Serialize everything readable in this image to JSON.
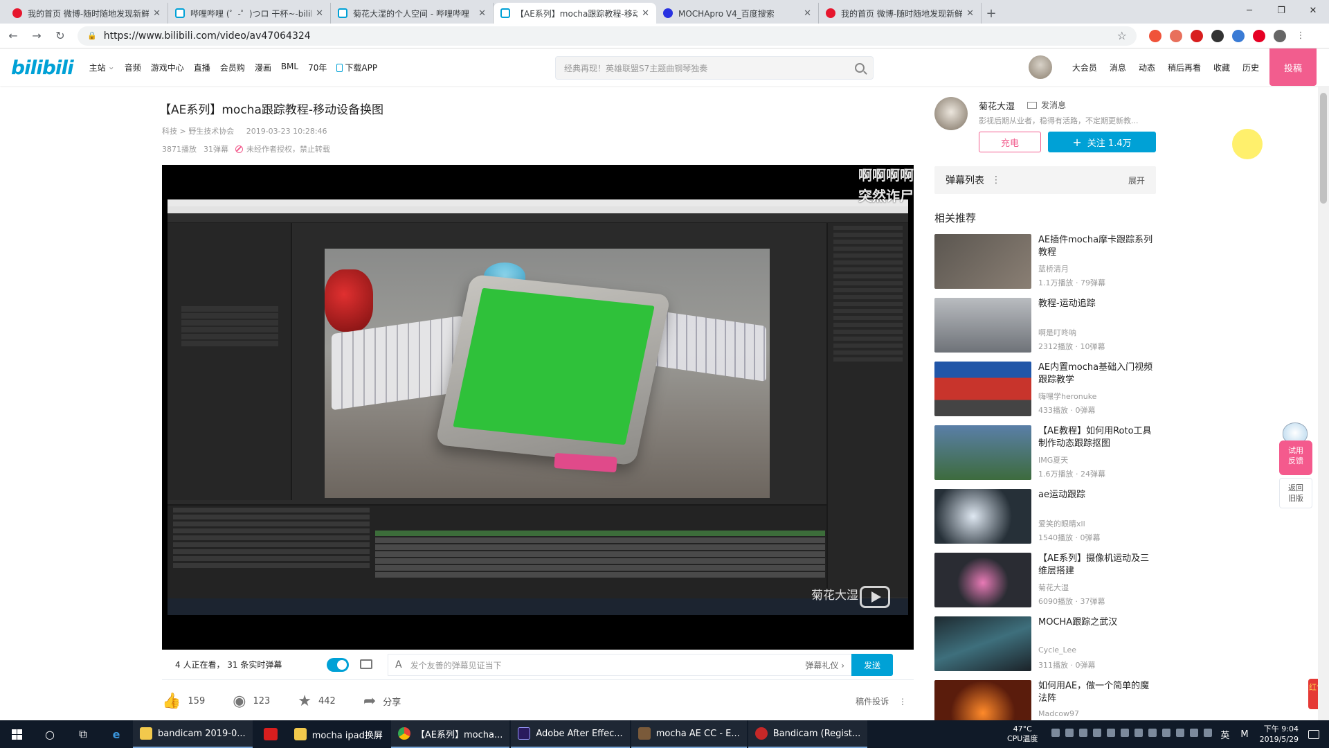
{
  "browser": {
    "tabs": [
      {
        "title": "我的首页 微博-随时随地发现新鲜",
        "favicon": "weibo-icon",
        "active": false
      },
      {
        "title": "哔哩哔哩 (゜-゜)つロ 干杯~-bilibili",
        "favicon": "bilibili-tv-icon",
        "active": false
      },
      {
        "title": "菊花大湿的个人空间 - 哔哩哔哩",
        "favicon": "bilibili-tv-icon",
        "active": false
      },
      {
        "title": "【AE系列】mocha跟踪教程-移动",
        "favicon": "bilibili-tv-icon",
        "active": true
      },
      {
        "title": "MOCHApro V4_百度搜索",
        "favicon": "baidu-icon",
        "active": false
      },
      {
        "title": "我的首页 微博-随时随地发现新鲜",
        "favicon": "weibo-icon",
        "active": false
      }
    ],
    "url": "https://www.bilibili.com/video/av47064324"
  },
  "site": {
    "logo": "bilibili",
    "nav": [
      "主站",
      "音频",
      "游戏中心",
      "直播",
      "会员购",
      "漫画",
      "BML",
      "70年",
      "下载APP"
    ],
    "search_placeholder": "经典再现！英雄联盟S7主题曲钢琴独奏",
    "header_links": [
      "大会员",
      "消息",
      "动态",
      "稍后再看",
      "收藏",
      "历史"
    ],
    "upload_label": "投稿"
  },
  "video": {
    "title": "【AE系列】mocha跟踪教程-移动设备换图",
    "category": "科技 > 野生技术协会",
    "date": "2019-03-23 10:28:46",
    "plays": "3871播放",
    "danmaku_count": "31弹幕",
    "copyright": "未经作者授权，禁止转载",
    "overlay_danmaku": [
      "啊啊啊啊",
      "突然诈尸"
    ],
    "watermark": "菊花大湿"
  },
  "danmaku_bar": {
    "viewers": "4 人正在看， 31 条实时弹幕",
    "input_placeholder": "发个友善的弹幕见证当下",
    "etiquette": "弹幕礼仪 ›",
    "send": "发送"
  },
  "actions": {
    "like": "159",
    "coin": "123",
    "favorite": "442",
    "share": "分享",
    "report": "稿件投诉"
  },
  "uploader": {
    "name": "菊花大湿",
    "message": "发消息",
    "desc": "影视后期从业者，稳得有活路，不定期更新教...",
    "charge": "充电",
    "follow": "关注 1.4万"
  },
  "danmaku_list": {
    "label": "弹幕列表",
    "expand": "展开"
  },
  "recommend": {
    "title": "相关推荐",
    "items": [
      {
        "name": "AE插件mocha摩卡跟踪系列教程",
        "up": "蓝桥清月",
        "stats": "1.1万播放 · 79弹幕",
        "thumb": "#6b6660"
      },
      {
        "name": "教程-运动追踪",
        "up": "啊是叮咚呐",
        "stats": "2312播放 · 10弹幕",
        "thumb": "#8f9399"
      },
      {
        "name": "AE内置mocha基础入门视频跟踪教学",
        "up": "嗨嘿学heronuke",
        "stats": "433播放 · 0弹幕",
        "thumb": "#b7332c"
      },
      {
        "name": "【AE教程】如何用Roto工具制作动态跟踪抠图",
        "up": "IMG夏天",
        "stats": "1.6万播放 · 24弹幕",
        "thumb": "#4b6e8f"
      },
      {
        "name": "ae运动跟踪",
        "up": "爱笑的眼睛xll",
        "stats": "1540播放 · 0弹幕",
        "thumb": "#3a4550"
      },
      {
        "name": "【AE系列】摄像机运动及三维层搭建",
        "up": "菊花大湿",
        "stats": "6090播放 · 37弹幕",
        "thumb": "#2d2f36"
      },
      {
        "name": "MOCHA跟踪之武汉",
        "up": "Cycle_Lee",
        "stats": "311播放 · 0弹幕",
        "thumb": "#2a3a44"
      },
      {
        "name": "如何用AE，做一个简单的魔法阵",
        "up": "Madcow97",
        "stats": "",
        "thumb": "#5a1c0c"
      }
    ]
  },
  "side": {
    "feedback": "试用\n反馈",
    "back_old": "返回\n旧版",
    "hongbao": "红包"
  },
  "taskbar": {
    "apps": [
      "bandicam 2019-0...",
      "mocha ipad换屏",
      "【AE系列】mocha...",
      "Adobe After Effec...",
      "mocha AE CC - E...",
      "Bandicam (Regist..."
    ],
    "temp": "47°C",
    "temp_label": "CPU温度",
    "ime": "英",
    "time": "下午 9:04",
    "date": "2019/5/29"
  },
  "colors": {
    "accent": "#00a1d6",
    "pink": "#f25d8e"
  }
}
